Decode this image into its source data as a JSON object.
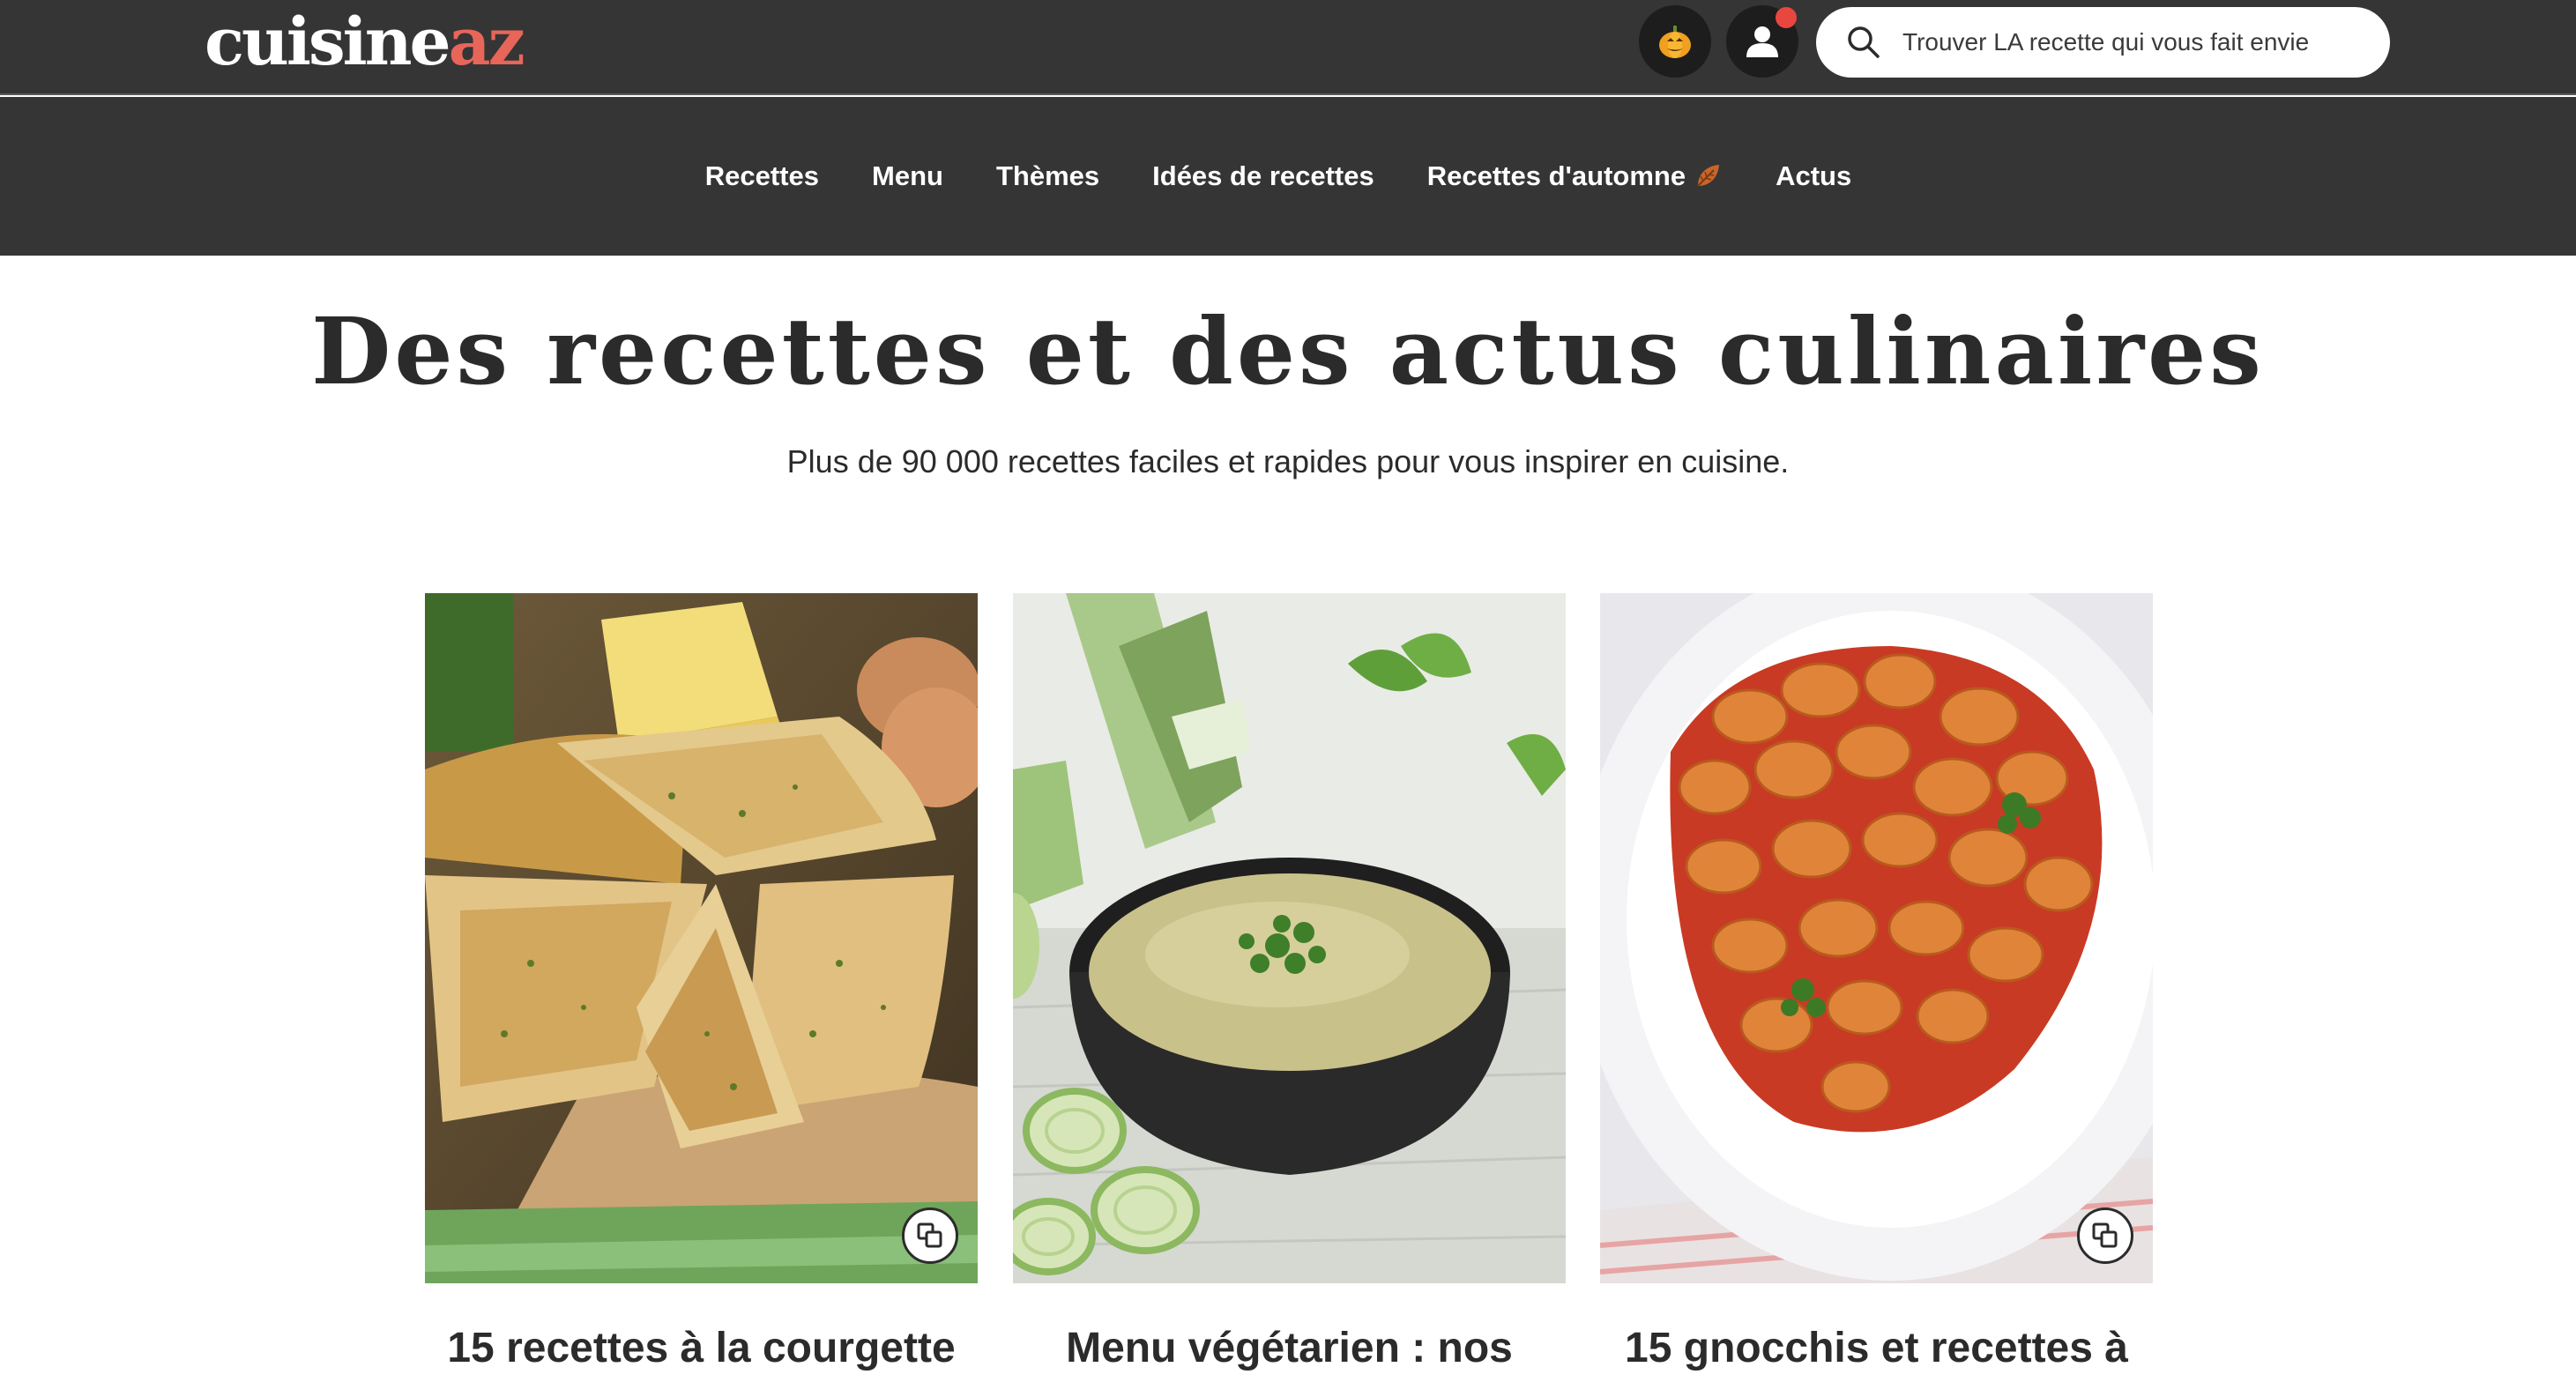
{
  "header": {
    "logo": {
      "part_a": "cuisine",
      "part_b": "az"
    },
    "search": {
      "placeholder": "Trouver LA recette qui vous fait envie"
    },
    "icons": {
      "search": "search-icon",
      "seasonal": "pumpkin-icon",
      "account": "user-icon"
    },
    "colors": {
      "bar": "#353535",
      "logo_accent": "#e8655a",
      "notification": "#e8473f"
    }
  },
  "nav": {
    "items": [
      {
        "label": "Recettes"
      },
      {
        "label": "Menu"
      },
      {
        "label": "Thèmes"
      },
      {
        "label": "Idées de recettes"
      },
      {
        "label": "Recettes d'automne",
        "icon": "autumn-leaf-icon"
      },
      {
        "label": "Actus"
      }
    ]
  },
  "hero": {
    "title": "Des recettes et des actus culinaires",
    "subtitle": "Plus de 90 000 recettes faciles et rapides pour vous inspirer en cuisine."
  },
  "cards": [
    {
      "title": "15 recettes à la courgette",
      "image": "zucchini-frittata-photo",
      "gallery_badge": true
    },
    {
      "title": "Menu végétarien : nos",
      "image": "leek-soup-photo",
      "gallery_badge": false
    },
    {
      "title": "15 gnocchis et recettes à",
      "image": "gnocchi-tomato-photo",
      "gallery_badge": true
    }
  ]
}
